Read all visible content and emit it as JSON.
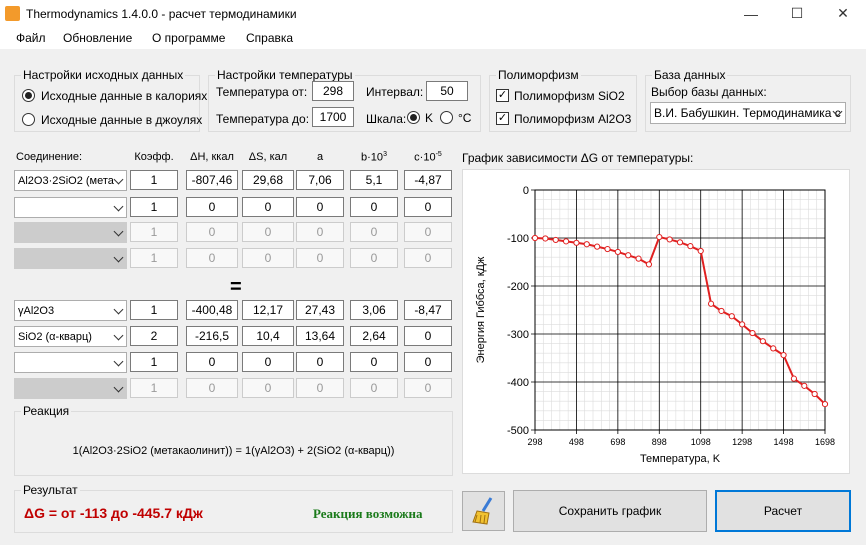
{
  "window": {
    "title": "Thermodynamics 1.4.0.0 - расчет термодинамики",
    "minimize": "—",
    "maximize": "☐",
    "close": "✕"
  },
  "menu": [
    "Файл",
    "Обновление",
    "О программе",
    "Справка"
  ],
  "source": {
    "legend": "Настройки исходных данных",
    "opt1": "Исходные данные в калориях",
    "opt2": "Исходные данные в джоулях"
  },
  "temp": {
    "legend": "Настройки температуры",
    "from_label": "Температура от:",
    "from": "298",
    "to_label": "Температура до:",
    "to": "1700",
    "interval_label": "Интервал:",
    "interval": "50",
    "scale_label": "Шкала:",
    "k": "K",
    "c": "°C"
  },
  "poly": {
    "legend": "Полиморфизм",
    "sio2": "Полиморфизм SiO2",
    "al2o3": "Полиморфизм Al2O3"
  },
  "db": {
    "legend": "База данных",
    "label": "Выбор базы данных:",
    "value": "В.И. Бабушкин. Термодинамика с"
  },
  "headers": {
    "compound": "Соединение:",
    "coef": "Коэфф.",
    "dh": "ΔH, ккал",
    "ds": "ΔS, кал",
    "a": "a",
    "b": "b·10",
    "b_exp": "3",
    "c": "c·10",
    "c_exp": "-5"
  },
  "rows": [
    {
      "name": "Al2O3·2SiO2 (мета",
      "coef": "1",
      "dh": "-807,46",
      "ds": "29,68",
      "a": "7,06",
      "b": "5,1",
      "c": "-4,87"
    },
    {
      "name": "",
      "coef": "1",
      "dh": "0",
      "ds": "0",
      "a": "0",
      "b": "0",
      "c": "0"
    },
    {
      "name": "",
      "coef": "1",
      "dh": "0",
      "ds": "0",
      "a": "0",
      "b": "0",
      "c": "0"
    },
    {
      "name": "",
      "coef": "1",
      "dh": "0",
      "ds": "0",
      "a": "0",
      "b": "0",
      "c": "0"
    },
    {
      "name": "γAl2O3",
      "coef": "1",
      "dh": "-400,48",
      "ds": "12,17",
      "a": "27,43",
      "b": "3,06",
      "c": "-8,47"
    },
    {
      "name": "SiO2 (α-кварц)",
      "coef": "2",
      "dh": "-216,5",
      "ds": "10,4",
      "a": "13,64",
      "b": "2,64",
      "c": "0"
    },
    {
      "name": "",
      "coef": "1",
      "dh": "0",
      "ds": "0",
      "a": "0",
      "b": "0",
      "c": "0"
    },
    {
      "name": "",
      "coef": "1",
      "dh": "0",
      "ds": "0",
      "a": "0",
      "b": "0",
      "c": "0"
    }
  ],
  "equals": "=",
  "reaction": {
    "legend": "Реакция",
    "text": "1(Al2O3·2SiO2 (метакаолинит)) = 1(γAl2O3) + 2(SiO2 (α-кварц))"
  },
  "result": {
    "legend": "Результат",
    "dg": "ΔG = от -113 до -445.7 кДж",
    "status": "Реакция возможна"
  },
  "buttons": {
    "save": "Сохранить график",
    "calc": "Расчет",
    "clear_icon": "broom-icon"
  },
  "chart_title": "График зависимости ΔG от температуры:",
  "chart_data": {
    "type": "line",
    "xlabel": "Температура, K",
    "ylabel": "Энергия Гиббса, кДж",
    "xlim": [
      298,
      1698
    ],
    "ylim": [
      -500,
      0
    ],
    "x_ticks": [
      298,
      498,
      698,
      898,
      1098,
      1298,
      1498,
      1698
    ],
    "y_ticks": [
      0,
      -100,
      -200,
      -300,
      -400,
      -500
    ],
    "grid": true,
    "series": [
      {
        "color": "#e02020",
        "x": [
          298,
          348,
          398,
          448,
          498,
          548,
          598,
          648,
          698,
          748,
          798,
          848,
          898,
          948,
          998,
          1048,
          1098,
          1148,
          1198,
          1248,
          1298,
          1348,
          1398,
          1448,
          1498,
          1548,
          1598,
          1648,
          1698
        ],
        "y": [
          -100,
          -101,
          -104,
          -107,
          -110,
          -113,
          -118,
          -123,
          -129,
          -136,
          -143,
          -155,
          -98,
          -103,
          -109,
          -117,
          -127,
          -237,
          -252,
          -263,
          -280,
          -298,
          -315,
          -330,
          -344,
          -393,
          -408,
          -425,
          -446
        ]
      }
    ]
  }
}
